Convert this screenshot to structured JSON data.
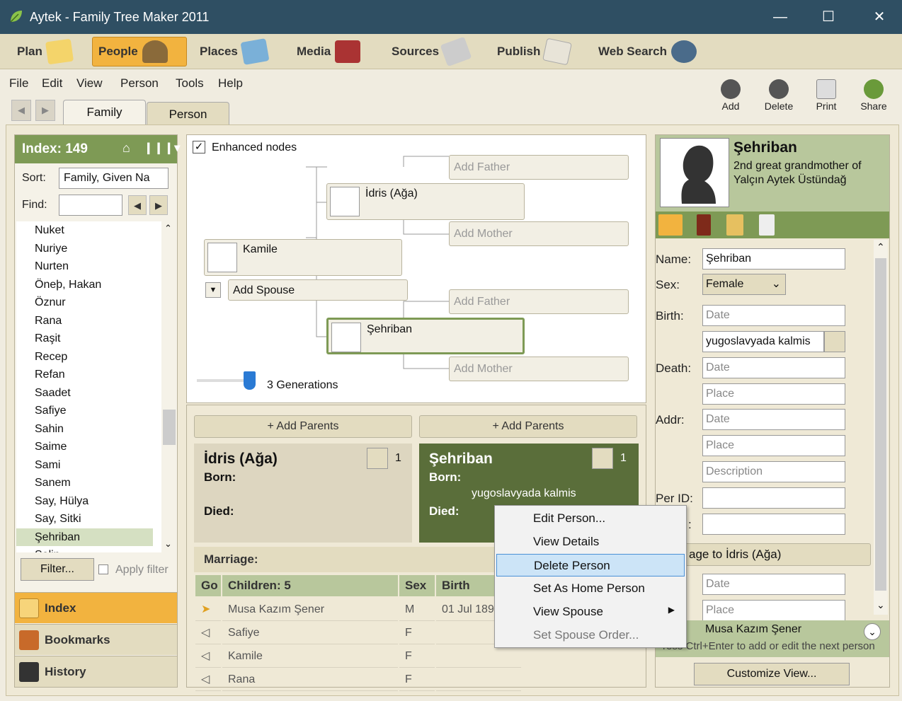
{
  "window": {
    "title": "Aytek - Family Tree Maker 2011"
  },
  "maintabs": [
    {
      "label": "Plan",
      "icon": "plan-icon"
    },
    {
      "label": "People",
      "icon": "people-icon"
    },
    {
      "label": "Places",
      "icon": "places-icon"
    },
    {
      "label": "Media",
      "icon": "media-icon"
    },
    {
      "label": "Sources",
      "icon": "sources-icon"
    },
    {
      "label": "Publish",
      "icon": "publish-icon"
    },
    {
      "label": "Web Search",
      "icon": "binoculars-icon"
    }
  ],
  "menu": [
    "File",
    "Edit",
    "View",
    "Person",
    "Tools",
    "Help"
  ],
  "righttools": [
    "Add",
    "Delete",
    "Print",
    "Share"
  ],
  "viewtabs": [
    "Family",
    "Person"
  ],
  "index": {
    "header": "Index: 149",
    "sort_label": "Sort:",
    "sort_value": "Family, Given Na",
    "find_label": "Find:",
    "find_value": "",
    "names": [
      "Nuket",
      "Nuriye",
      "Nurten",
      "Öneþ, Hakan",
      "Öznur",
      "Rana",
      "Raşit",
      "Recep",
      "Refan",
      "Saadet",
      "Safiye",
      "Sahin",
      "Saime",
      "Sami",
      "Sanem",
      "Say, Hülya",
      "Say, Sitki",
      "Şehriban",
      "Selin"
    ],
    "selected": "Şehriban",
    "filter_btn": "Filter...",
    "apply_filter": "Apply filter",
    "bottom": [
      "Index",
      "Bookmarks",
      "History"
    ]
  },
  "tree": {
    "enhanced_label": "Enhanced nodes",
    "nodes": {
      "father": "İdris (Ağa)",
      "wife": "Şehriban",
      "kamile": "Kamile",
      "add_spouse": "Add Spouse",
      "add_father1": "Add Father",
      "add_mother1": "Add Mother",
      "add_father2": "Add Father",
      "add_mother2": "Add Mother"
    },
    "generations": "3 Generations"
  },
  "family": {
    "add_parents": "+ Add Parents",
    "husband": {
      "name": "İdris (Ağa)",
      "born": "Born:",
      "died": "Died:",
      "count": "1"
    },
    "wife": {
      "name": "Şehriban",
      "born": "Born:",
      "born_place": "yugoslavyada kalmis",
      "died": "Died:",
      "count": "1"
    },
    "marriage": "Marriage:",
    "cols": [
      "Go",
      "Children: 5",
      "Sex",
      "Birth"
    ],
    "children": [
      {
        "name": "Musa Kazım Şener",
        "sex": "M",
        "birth": "01 Jul 1890"
      },
      {
        "name": "Safiye",
        "sex": "F",
        "birth": ""
      },
      {
        "name": "Kamile",
        "sex": "F",
        "birth": ""
      },
      {
        "name": "Rana",
        "sex": "F",
        "birth": ""
      }
    ]
  },
  "editor": {
    "name": "Şehriban",
    "relation": "2nd great grandmother of Yalçın Aytek Üstündağ",
    "labels": {
      "name": "Name:",
      "sex": "Sex:",
      "birth": "Birth:",
      "death": "Death:",
      "addr": "Addr:",
      "perid": "Per ID:",
      "last": ":"
    },
    "name_value": "Şehriban",
    "sex_value": "Female",
    "birth_date_ph": "Date",
    "birth_place": "yugoslavyada kalmis",
    "death_date_ph": "Date",
    "death_place_ph": "Place",
    "addr_date_ph": "Date",
    "addr_place_ph": "Place",
    "addr_desc_ph": "Description",
    "marriage_hdr": "age to İdris (Ağa)",
    "m_date_ph": "Date",
    "m_place_ph": "Place",
    "next_child": "Musa Kazım Şener",
    "hint": "ress Ctrl+Enter to add or edit the next person",
    "customize": "Customize View..."
  },
  "context_menu": [
    {
      "label": "Edit Person...",
      "state": "normal"
    },
    {
      "label": "View Details",
      "state": "normal"
    },
    {
      "label": "Delete Person",
      "state": "highlight"
    },
    {
      "label": "Set As Home Person",
      "state": "normal"
    },
    {
      "label": "View Spouse",
      "state": "submenu"
    },
    {
      "label": "Set Spouse Order...",
      "state": "disabled"
    }
  ],
  "colors": {
    "titlebar": "#2f4f63",
    "accent": "#f2b33f",
    "green": "#7e9a55",
    "dark_green": "#5a6e3a"
  }
}
